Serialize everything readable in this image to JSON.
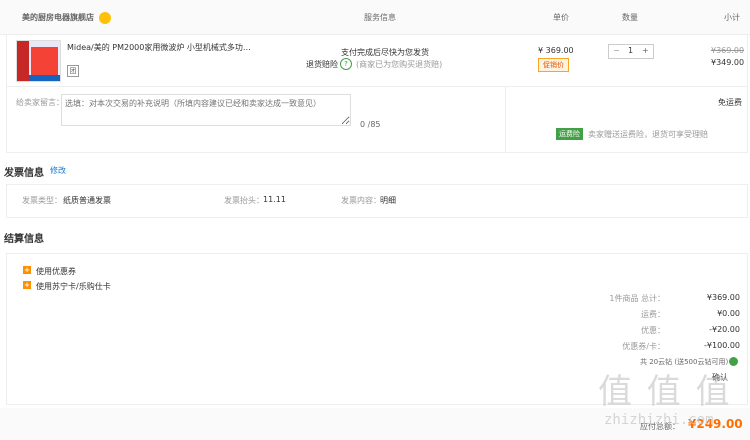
{
  "header": {
    "shop": "美的厨房电器旗舰店",
    "service": "服务信息",
    "price": "单价",
    "qty": "数量",
    "subtotal": "小计"
  },
  "item": {
    "name": "Midea/美的 PM2000家用微波炉 小型机械式多功能 ...",
    "tag": "团",
    "svc_line1": "支付完成后尽快为您发货",
    "svc_line2": "退货赔险",
    "svc_line3": "(商家已为您购买退货赔)",
    "price": "¥ 369.00",
    "promo": "促销价",
    "qty": "1",
    "minus": "−",
    "plus": "+",
    "old_price": "¥369.00",
    "subtotal": "¥349.00"
  },
  "message": {
    "label": "给卖家留言：",
    "placeholder": "选填：对本次交易的补充说明（所填内容建议已经和卖家达成一致意见）",
    "counter": "0 /85"
  },
  "shipping": {
    "free": "免运费",
    "tag": "运费险",
    "text": "卖家赠送运费险，退货可享受理赔"
  },
  "invoice": {
    "title": "发票信息",
    "edit": "修改",
    "type_label": "发票类型：",
    "type_value": "纸质普通发票",
    "head_label": "发票抬头：",
    "head_value": "11.11",
    "content_label": "发票内容：",
    "content_value": "明细"
  },
  "payment": {
    "title": "结算信息",
    "coupon": "使用优惠券",
    "card": "使用苏宁卡/乐购仕卡",
    "rows": [
      {
        "label": "1件商品 总计：",
        "value": "¥369.00"
      },
      {
        "label": "运费：",
        "value": "¥0.00"
      },
      {
        "label": "优惠：",
        "value": "-¥20.00"
      },
      {
        "label": "优惠券/卡：",
        "value": "-¥100.00"
      }
    ],
    "points": "共 20云钻 (送500云钻可用)",
    "points_extra": "确认"
  },
  "footer": {
    "label": "应付总额：",
    "value": "¥249.00"
  },
  "watermark": {
    "big": "值 值 值",
    "small": "zhizhizhi.com"
  }
}
